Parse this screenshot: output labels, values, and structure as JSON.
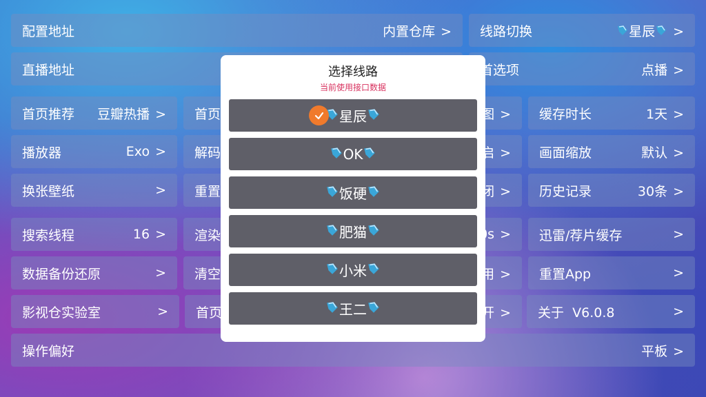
{
  "settings": {
    "config_addr": {
      "label": "配置地址",
      "value": "内置仓库"
    },
    "route_switch": {
      "label": "线路切换",
      "value": "星辰"
    },
    "live_addr": {
      "label": "直播地址"
    },
    "home_option": {
      "label_partial": "首选项",
      "value": "点播"
    },
    "home_rec": {
      "label": "首页推荐",
      "value": "豆瓣热播"
    },
    "home_partial": {
      "label_partial": "首页"
    },
    "img_partial": {
      "label_partial": "图"
    },
    "cache_time": {
      "label": "缓存时长",
      "value": "1天"
    },
    "player": {
      "label": "播放器",
      "value": "Exo"
    },
    "decode_partial": {
      "label_partial": "解码"
    },
    "open_partial": {
      "label_partial": "启"
    },
    "scale": {
      "label": "画面缩放",
      "value": "默认"
    },
    "wallpaper": {
      "label": "换张壁纸"
    },
    "reset_partial": {
      "label_partial": "重置"
    },
    "close_partial": {
      "label_partial": "闭"
    },
    "history": {
      "label": "历史记录",
      "value": "30条"
    },
    "search_threads": {
      "label": "搜索线程",
      "value": "16"
    },
    "render_partial": {
      "label_partial": "渲染"
    },
    "os_partial": {
      "label_partial": "0s"
    },
    "thunder_cache": {
      "label": "迅雷/荐片缓存"
    },
    "backup": {
      "label": "数据备份还原"
    },
    "clear_partial": {
      "label_partial": "清空"
    },
    "use_partial": {
      "label_partial": "用"
    },
    "reset_app": {
      "label": "重置App"
    },
    "lab": {
      "label": "影视仓实验室"
    },
    "home2_partial": {
      "label_partial": "首页"
    },
    "open2_partial": {
      "label_partial": "开"
    },
    "about": {
      "label": "关于",
      "value": "V6.0.8"
    },
    "preference": {
      "label": "操作偏好",
      "value": "平板"
    }
  },
  "arrow": ">",
  "dialog": {
    "title": "选择线路",
    "subtitle": "当前使用接口数据",
    "options": [
      {
        "label": "星辰",
        "selected": true
      },
      {
        "label": "OK",
        "selected": false
      },
      {
        "label": "饭硬",
        "selected": false
      },
      {
        "label": "肥猫",
        "selected": false
      },
      {
        "label": "小米",
        "selected": false
      },
      {
        "label": "王二",
        "selected": false
      }
    ]
  },
  "colors": {
    "accent": "#f07a2c",
    "subtitle": "#d8325f",
    "option_bg": "#5f5f68"
  },
  "icons": {
    "route_marker": "blue-leaf-icon",
    "selected": "check-circle-icon"
  }
}
